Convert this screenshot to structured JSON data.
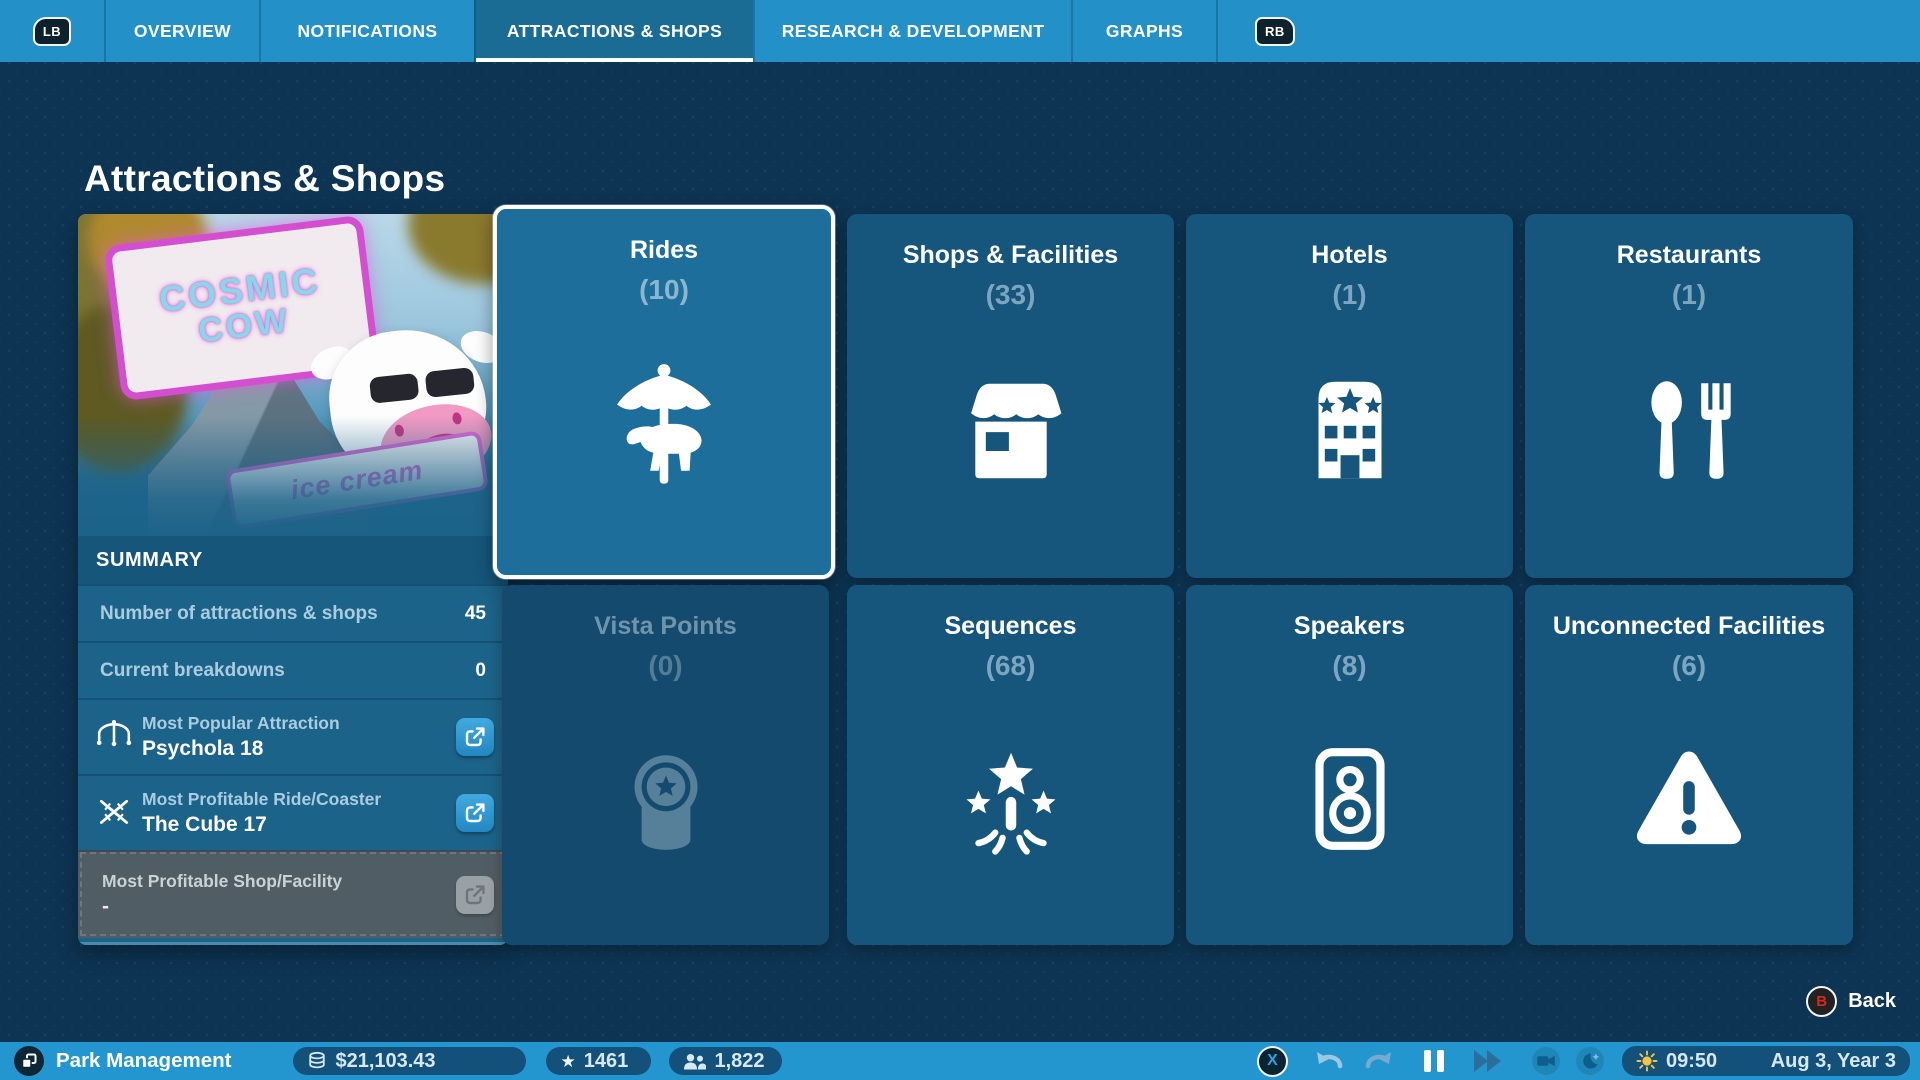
{
  "nav": {
    "lb": "LB",
    "rb": "RB",
    "tabs": [
      {
        "label": "OVERVIEW"
      },
      {
        "label": "NOTIFICATIONS"
      },
      {
        "label": "ATTRACTIONS & SHOPS"
      },
      {
        "label": "RESEARCH & DEVELOPMENT"
      },
      {
        "label": "GRAPHS"
      }
    ]
  },
  "page": {
    "title": "Attractions & Shops"
  },
  "summary": {
    "header": "SUMMARY",
    "photo": {
      "sign_line1": "COSMIC",
      "sign_line2": "COW",
      "banner": "ice cream"
    },
    "stats": [
      {
        "label": "Number of attractions & shops",
        "value": "45"
      },
      {
        "label": "Current breakdowns",
        "value": "0"
      }
    ],
    "highlights": [
      {
        "label": "Most Popular Attraction",
        "value": "Psychola 18",
        "icon": "swing-ride-icon",
        "disabled": false
      },
      {
        "label": "Most Profitable Ride/Coaster",
        "value": "The Cube 17",
        "icon": "coaster-icon",
        "disabled": false
      },
      {
        "label": "Most Profitable Shop/Facility",
        "value": "-",
        "icon": "none",
        "disabled": true
      }
    ]
  },
  "tiles": [
    {
      "label": "Rides",
      "count": "(10)",
      "icon": "carousel-icon",
      "state": "selected"
    },
    {
      "label": "Shops & Facilities",
      "count": "(33)",
      "icon": "shop-stall-icon",
      "state": "normal"
    },
    {
      "label": "Hotels",
      "count": "(1)",
      "icon": "hotel-icon",
      "state": "normal"
    },
    {
      "label": "Restaurants",
      "count": "(1)",
      "icon": "cutlery-icon",
      "state": "normal"
    },
    {
      "label": "Vista Points",
      "count": "(0)",
      "icon": "vista-point-icon",
      "state": "disabled"
    },
    {
      "label": "Sequences",
      "count": "(68)",
      "icon": "fireworks-icon",
      "state": "normal"
    },
    {
      "label": "Speakers",
      "count": "(8)",
      "icon": "speaker-icon",
      "state": "normal"
    },
    {
      "label": "Unconnected Facilities",
      "count": "(6)",
      "icon": "warning-icon",
      "state": "normal"
    }
  ],
  "back": {
    "glyph": "B",
    "label": "Back"
  },
  "statusbar": {
    "mode_label": "Park Management",
    "money": "$21,103.43",
    "rating": "1461",
    "guests": "1,822",
    "x_glyph": "X",
    "time": "09:50",
    "date": "Aug 3, Year 3"
  },
  "colors": {
    "topbar": "#2391c7",
    "active_tab": "#1b6c95",
    "background": "#0d3452",
    "tile": "#17567c",
    "tile_selected": "#1e6e9b",
    "accent_blue": "#2da2e0",
    "back_glyph_red": "#d42b1f",
    "sun_yellow": "#f6c445"
  }
}
